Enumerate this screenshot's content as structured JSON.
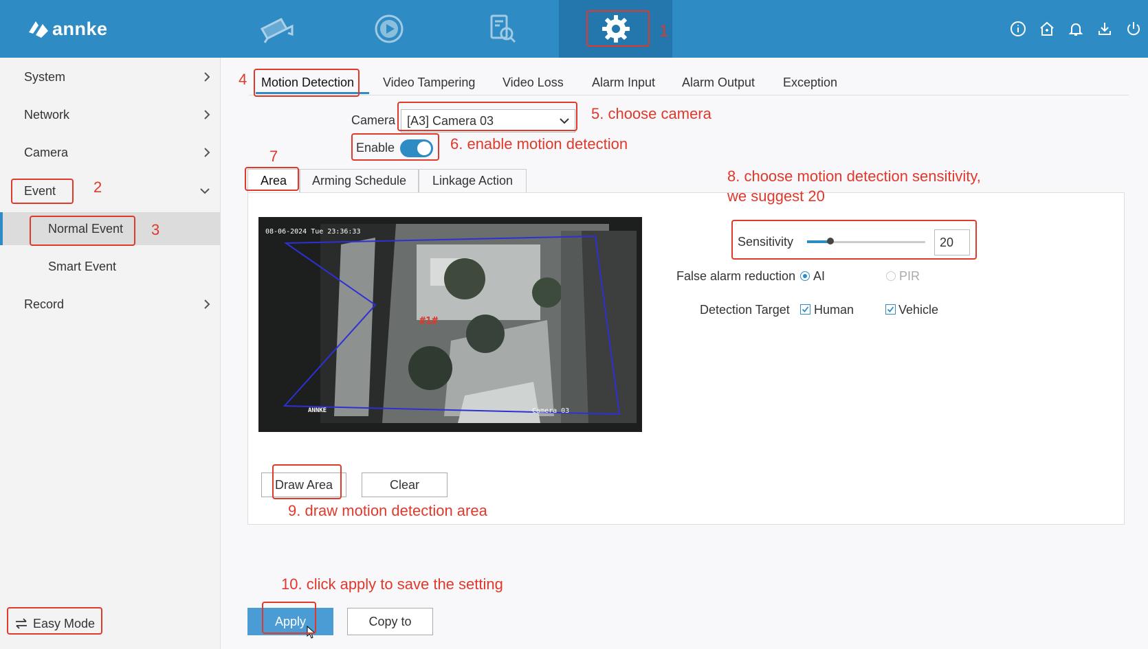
{
  "brand": {
    "logo_text": "annke"
  },
  "top_nav": {
    "items": [
      {
        "icon": "camera-icon"
      },
      {
        "icon": "playback-icon"
      },
      {
        "icon": "search-icon"
      },
      {
        "icon": "gear-icon",
        "active": true
      }
    ],
    "right_icons": [
      "info-icon",
      "home-icon",
      "bell-icon",
      "download-icon",
      "power-icon"
    ]
  },
  "sidebar": {
    "items": [
      {
        "label": "System"
      },
      {
        "label": "Network"
      },
      {
        "label": "Camera"
      },
      {
        "label": "Event",
        "expanded": true
      },
      {
        "label": "Record"
      }
    ],
    "sub_items": [
      {
        "label": "Normal Event",
        "active": true
      },
      {
        "label": "Smart Event"
      }
    ],
    "easy_mode": "Easy Mode"
  },
  "tabs": [
    "Motion Detection",
    "Video Tampering",
    "Video Loss",
    "Alarm Input",
    "Alarm Output",
    "Exception"
  ],
  "form": {
    "camera_label": "Camera",
    "camera_value": "[A3] Camera 03",
    "enable_label": "Enable",
    "enable_state": true
  },
  "sub_tabs": [
    "Area",
    "Arming Schedule",
    "Linkage Action"
  ],
  "video": {
    "timestamp": "08-06-2024 Tue 23:36:33",
    "area_label": "#1#",
    "watermark": "ANNKE",
    "camera_name": "Camera 03"
  },
  "sensitivity": {
    "label": "Sensitivity",
    "value": "20",
    "level_fraction": 0.2
  },
  "false_alarm": {
    "label": "False alarm reduction",
    "options": [
      "AI",
      "PIR"
    ],
    "selected": "AI"
  },
  "detection_target": {
    "label": "Detection Target",
    "options": [
      "Human",
      "Vehicle"
    ]
  },
  "buttons": {
    "draw_area": "Draw Area",
    "clear": "Clear",
    "apply": "Apply",
    "copy_to": "Copy to"
  },
  "annotations": {
    "a1": "1",
    "a2": "2",
    "a3": "3",
    "a4": "4",
    "a5": "5. choose camera",
    "a6": "6. enable motion detection",
    "a7": "7",
    "a8_line1": "8. choose motion detection sensitivity,",
    "a8_line2": "we suggest 20",
    "a9": "9. draw motion detection area",
    "a10": "10. click apply to save the setting"
  },
  "colors": {
    "header": "#2f8bc4",
    "annotation": "#e0392b",
    "primary_button": "#4b9bd4"
  }
}
